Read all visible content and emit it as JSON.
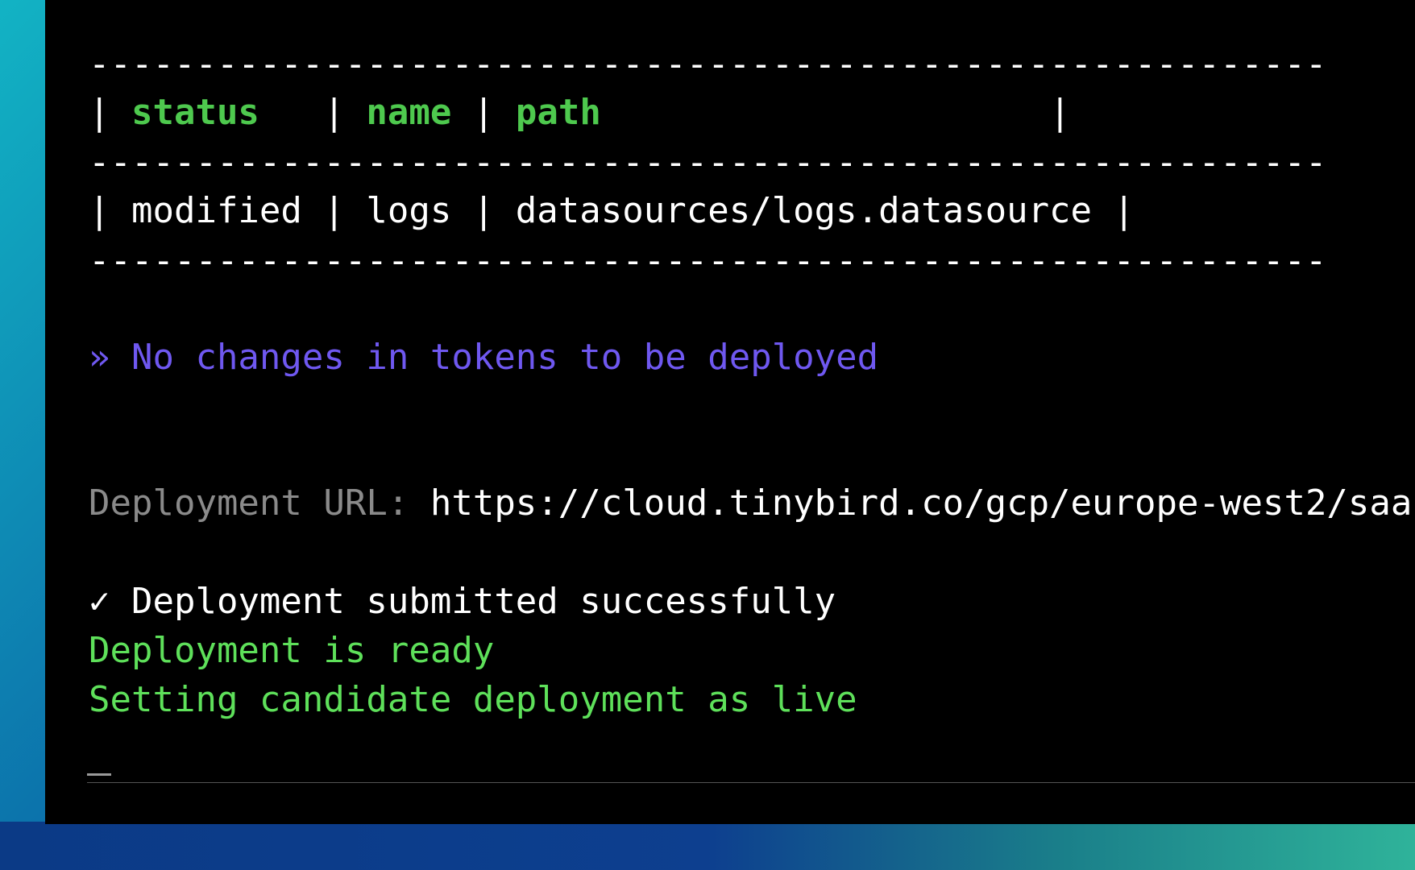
{
  "terminal": {
    "table": {
      "border": "----------------------------------------------------------",
      "header": {
        "pipe_open": "| ",
        "status": "status",
        "sep1": "   | ",
        "name": "name",
        "sep2": " | ",
        "path": "path",
        "pad_close": "                     |"
      },
      "row": {
        "text": "| modified | logs | datasources/logs.datasource |"
      }
    },
    "tokens_message": "» No changes in tokens to be deployed",
    "deployment_url_label": "Deployment URL: ",
    "deployment_url_value": "https://cloud.tinybird.co/gcp/europe-west2/saa",
    "submitted_message": "✓ Deployment submitted successfully",
    "ready_message": "Deployment is ready",
    "live_message": "Setting candidate deployment as live"
  },
  "colors": {
    "terminal_bg": "#000000",
    "header_green": "#4ec94e",
    "success_green": "#5ee05a",
    "info_purple": "#6f58f0",
    "label_gray": "#8a8a8a"
  }
}
